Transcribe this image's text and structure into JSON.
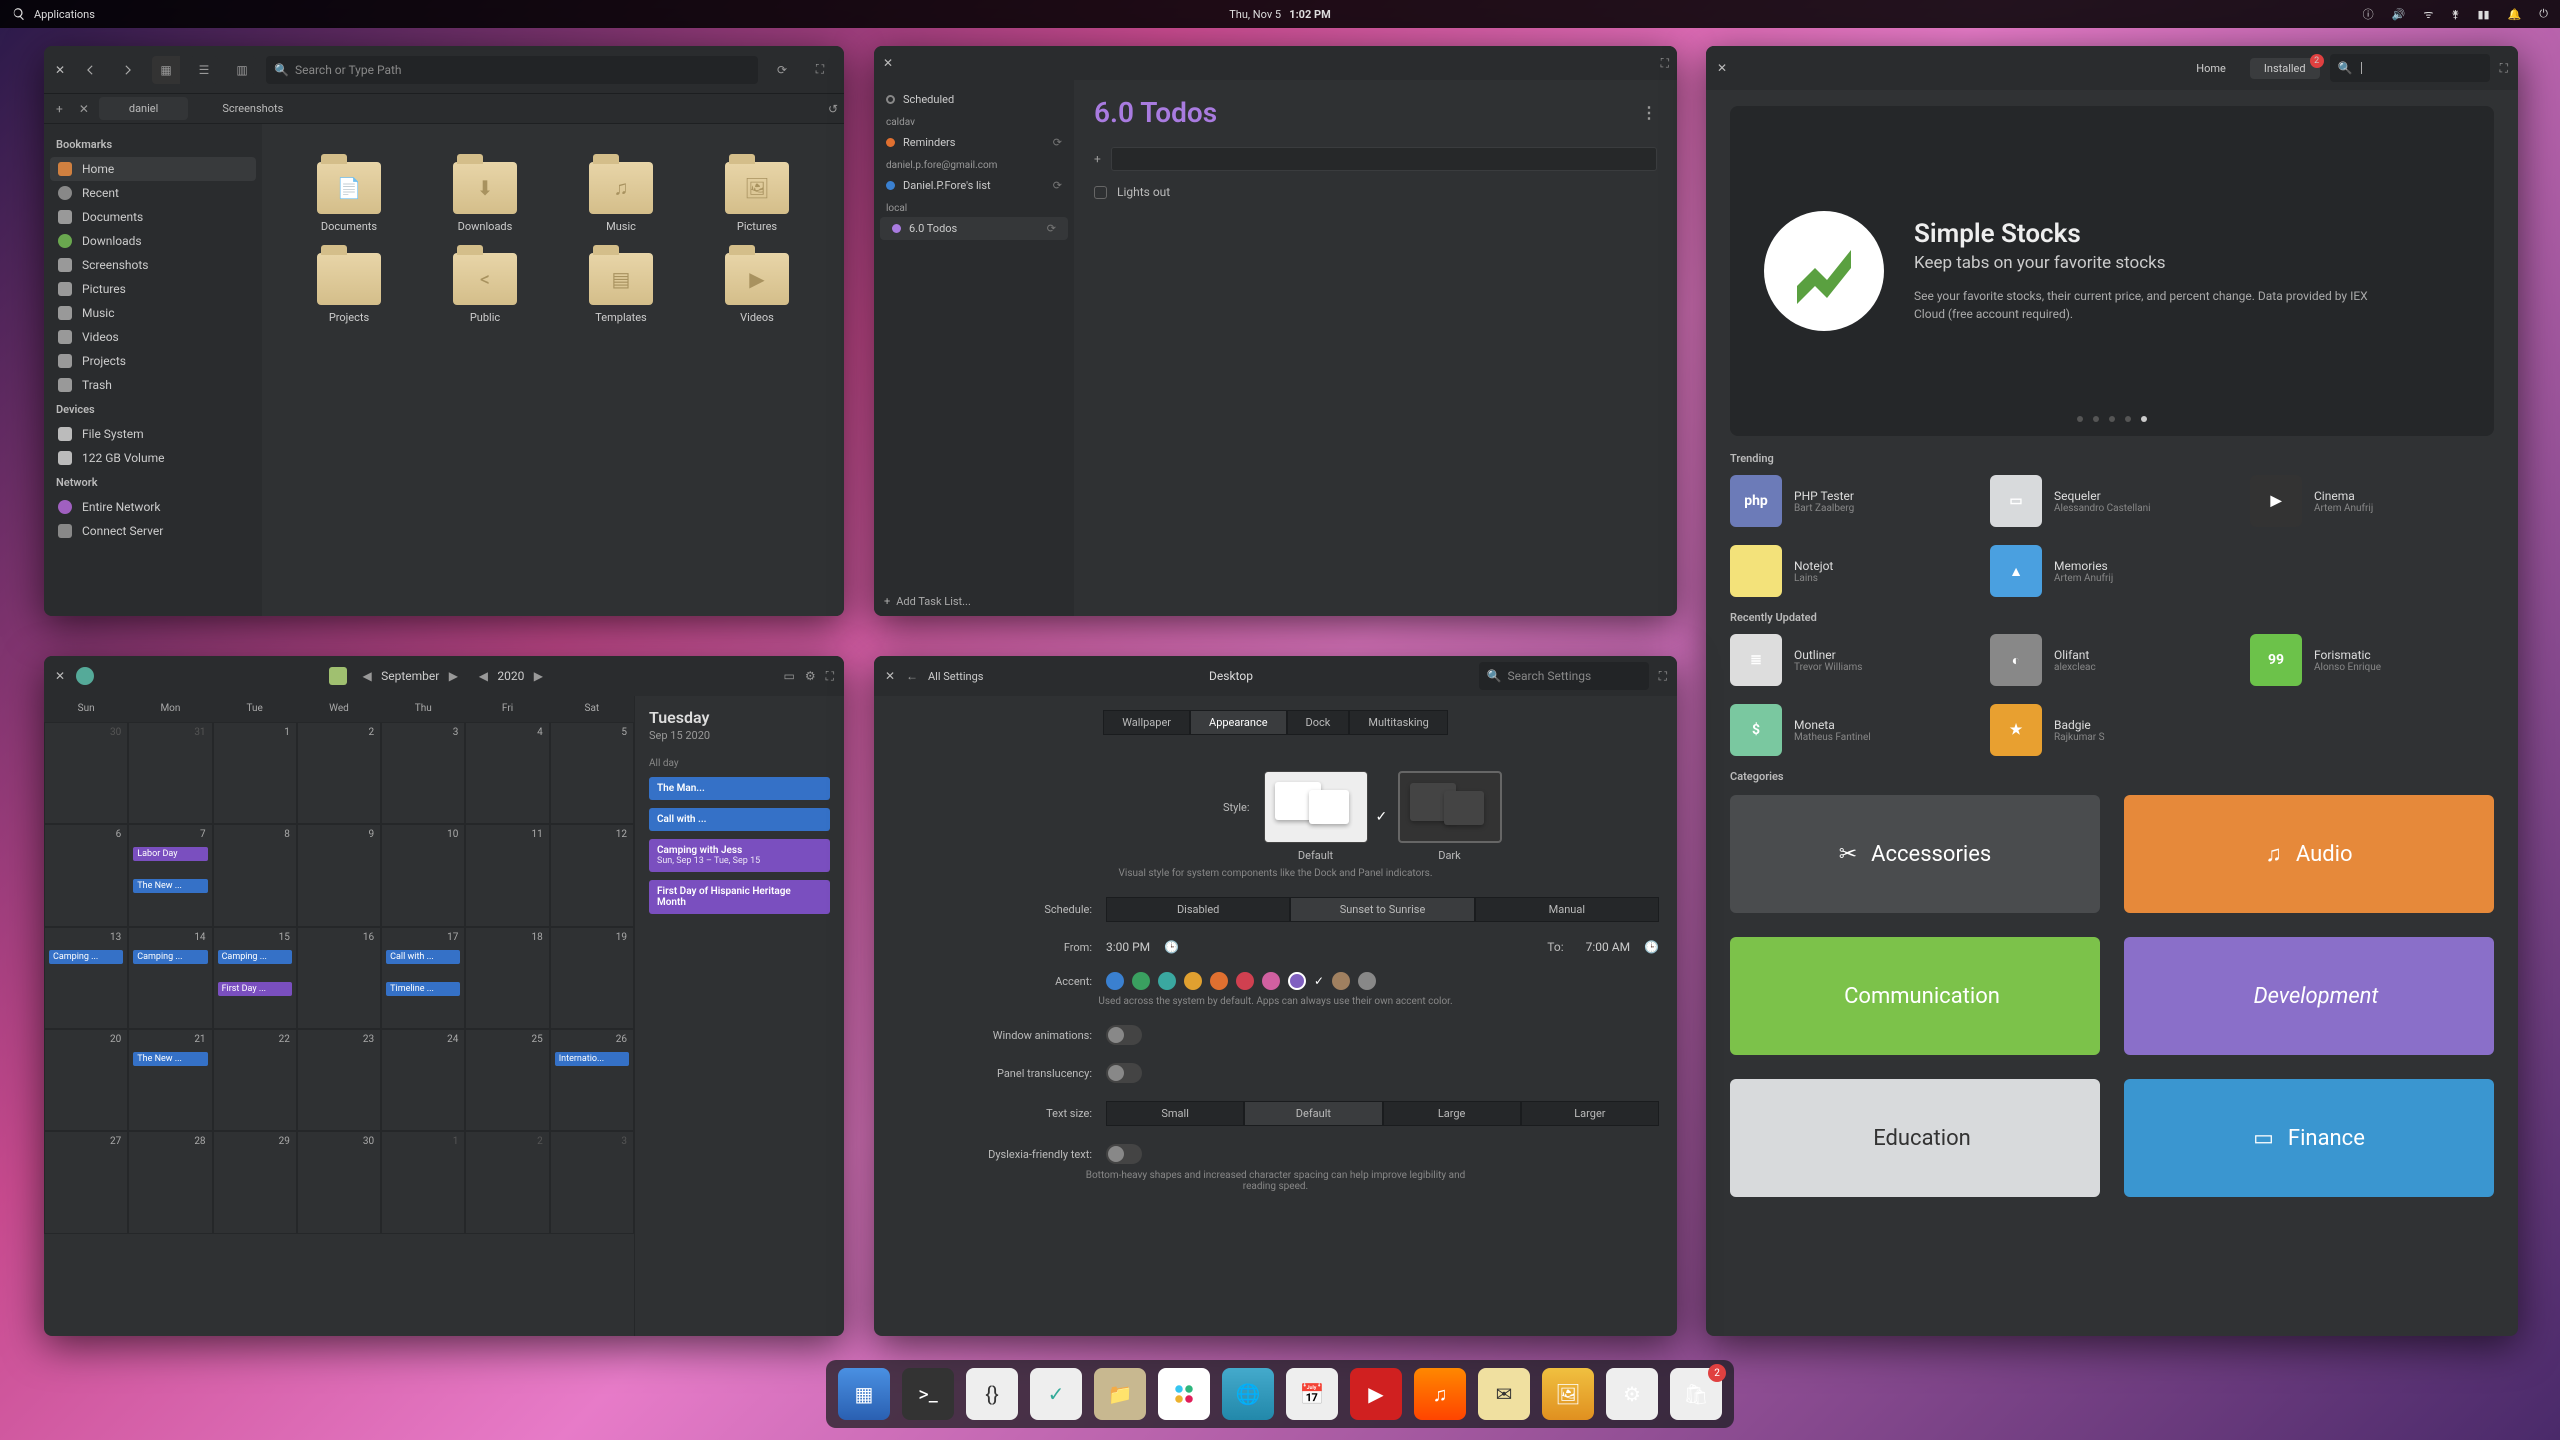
{
  "panel": {
    "apps": "Applications",
    "date": "Thu, Nov  5",
    "time": "1:02 PM"
  },
  "files": {
    "search_ph": "Search or Type Path",
    "tabs": [
      "daniel",
      "Screenshots"
    ],
    "sections": {
      "bookmarks": "Bookmarks",
      "devices": "Devices",
      "network": "Network"
    },
    "bookmarks": [
      "Home",
      "Recent",
      "Documents",
      "Downloads",
      "Screenshots",
      "Pictures",
      "Music",
      "Videos",
      "Projects",
      "Trash"
    ],
    "devices": [
      "File System",
      "122 GB Volume"
    ],
    "network": [
      "Entire Network",
      "Connect Server"
    ],
    "folders": [
      "Documents",
      "Downloads",
      "Music",
      "Pictures",
      "Projects",
      "Public",
      "Templates",
      "Videos"
    ]
  },
  "tasks": {
    "scheduled": "Scheduled",
    "groups": {
      "caldav": "caldav",
      "gmail": "daniel.p.fore@gmail.com",
      "local": "local"
    },
    "lists": {
      "reminders": "Reminders",
      "fores": "Daniel.P.Fore's list",
      "six": "6.0 Todos"
    },
    "title": "6.0 Todos",
    "item1": "Lights out",
    "add_list": "Add Task List..."
  },
  "appcenter": {
    "home": "Home",
    "installed": "Installed",
    "installed_badge": "2",
    "hero": {
      "title": "Simple Stocks",
      "subtitle": "Keep tabs on your favorite stocks",
      "desc": "See your favorite stocks, their current price, and percent change. Data provided by IEX Cloud (free account required)."
    },
    "sec_trending": "Trending",
    "trending": [
      {
        "name": "PHP Tester",
        "author": "Bart Zaalberg",
        "bg": "#6c7bb8",
        "txt": "php"
      },
      {
        "name": "Sequeler",
        "author": "Alessandro Castellani",
        "bg": "#d8dadc",
        "txt": "▭"
      },
      {
        "name": "Cinema",
        "author": "Artem Anufrij",
        "bg": "#333",
        "txt": "▶"
      },
      {
        "name": "Notejot",
        "author": "Lains",
        "bg": "#f3e27a",
        "txt": ""
      },
      {
        "name": "Memories",
        "author": "Artem Anufrij",
        "bg": "#4aa0e0",
        "txt": "▲"
      }
    ],
    "sec_updated": "Recently Updated",
    "updated": [
      {
        "name": "Outliner",
        "author": "Trevor Williams",
        "bg": "#ddd",
        "txt": "≣"
      },
      {
        "name": "Olifant",
        "author": "alexcleac",
        "bg": "#888",
        "txt": "◐"
      },
      {
        "name": "Forismatic",
        "author": "Alonso Enrique",
        "bg": "#6cc24a",
        "txt": "99"
      },
      {
        "name": "Moneta",
        "author": "Matheus Fantinel",
        "bg": "#7ac8a0",
        "txt": "$"
      },
      {
        "name": "Badgie",
        "author": "Rajkumar S",
        "bg": "#e8a030",
        "txt": "★"
      }
    ],
    "sec_categories": "Categories",
    "categories": [
      {
        "label": "Accessories",
        "bg": "#4a4c4e",
        "icon": "✂"
      },
      {
        "label": "Audio",
        "bg": "#e6893a",
        "icon": "♫"
      },
      {
        "label": "Communication",
        "bg": "#7cc24a",
        "icon": ""
      },
      {
        "label": "Development",
        "bg": "#8a6fc9",
        "icon": ""
      },
      {
        "label": "Education",
        "bg": "#d8dadc",
        "icon": ""
      },
      {
        "label": "Finance",
        "bg": "#3a96d0",
        "icon": "▭"
      }
    ]
  },
  "calendar": {
    "month": "September",
    "year": "2020",
    "dow": [
      "Sun",
      "Mon",
      "Tue",
      "Wed",
      "Thu",
      "Fri",
      "Sat"
    ],
    "agenda": {
      "day": "Tuesday",
      "date": "Sep 15 2020",
      "allday": "All day",
      "events": [
        {
          "title": "The Man...",
          "sub": ""
        },
        {
          "title": "Call with ...",
          "sub": ""
        },
        {
          "title": "Camping with Jess",
          "sub": "Sun, Sep 13 – Tue, Sep 15"
        },
        {
          "title": "First Day of Hispanic Heritage Month",
          "sub": ""
        }
      ]
    },
    "grid_events": {
      "labor": "Labor Day",
      "new": "The New ...",
      "camping": "Camping ...",
      "firstday": "First Day ...",
      "call": "Call with ...",
      "timeline": "Timeline ...",
      "intl": "Internatio..."
    }
  },
  "settings": {
    "title": "Desktop",
    "all": "All Settings",
    "search_ph": "Search Settings",
    "tabs": [
      "Wallpaper",
      "Appearance",
      "Dock",
      "Multitasking"
    ],
    "style_label": "Style:",
    "default": "Default",
    "dark": "Dark",
    "style_hint": "Visual style for system components like the Dock and Panel indicators.",
    "schedule_label": "Schedule:",
    "schedule_opts": [
      "Disabled",
      "Sunset to Sunrise",
      "Manual"
    ],
    "from": "From:",
    "from_val": "3:00 PM",
    "to": "To:",
    "to_val": "7:00 AM",
    "accent_label": "Accent:",
    "accent_hint": "Used across the system by default. Apps can always use their own accent color.",
    "anim_label": "Window animations:",
    "trans_label": "Panel translucency:",
    "text_label": "Text size:",
    "text_opts": [
      "Small",
      "Default",
      "Large",
      "Larger"
    ],
    "dys_label": "Dyslexia-friendly text:",
    "dys_hint": "Bottom-heavy shapes and increased character spacing can help improve legibility and reading speed."
  },
  "dock": {
    "badge": "2"
  }
}
